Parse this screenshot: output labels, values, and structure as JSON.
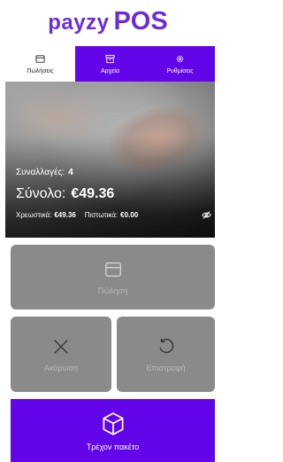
{
  "logo": {
    "brand": "payzy",
    "pos": "POS"
  },
  "tabs": [
    {
      "label": "Πωλήσεις",
      "icon": "card-icon",
      "active": true
    },
    {
      "label": "Αρχεία",
      "icon": "archive-icon",
      "active": false
    },
    {
      "label": "Ρυθμίσεις",
      "icon": "gear-icon",
      "active": false
    }
  ],
  "summary": {
    "transactions_label": "Συναλλαγές:",
    "transactions_value": "4",
    "total_label": "Σύνολο:",
    "total_value": "€49.36",
    "debit_label": "Χρεωστικά:",
    "debit_value": "€49.36",
    "credit_label": "Πιστωτικά:",
    "credit_value": "€0.00",
    "visibility_icon": "eye-off-icon"
  },
  "actions": {
    "sale_label": "Πώληση",
    "cancel_label": "Ακύρωση",
    "refund_label": "Επιστροφή",
    "package_label": "Τρέχον πακέτο"
  },
  "colors": {
    "brand": "#6b2cd9",
    "accent": "#6205e8",
    "disabled_button": "#8a8a8a"
  }
}
